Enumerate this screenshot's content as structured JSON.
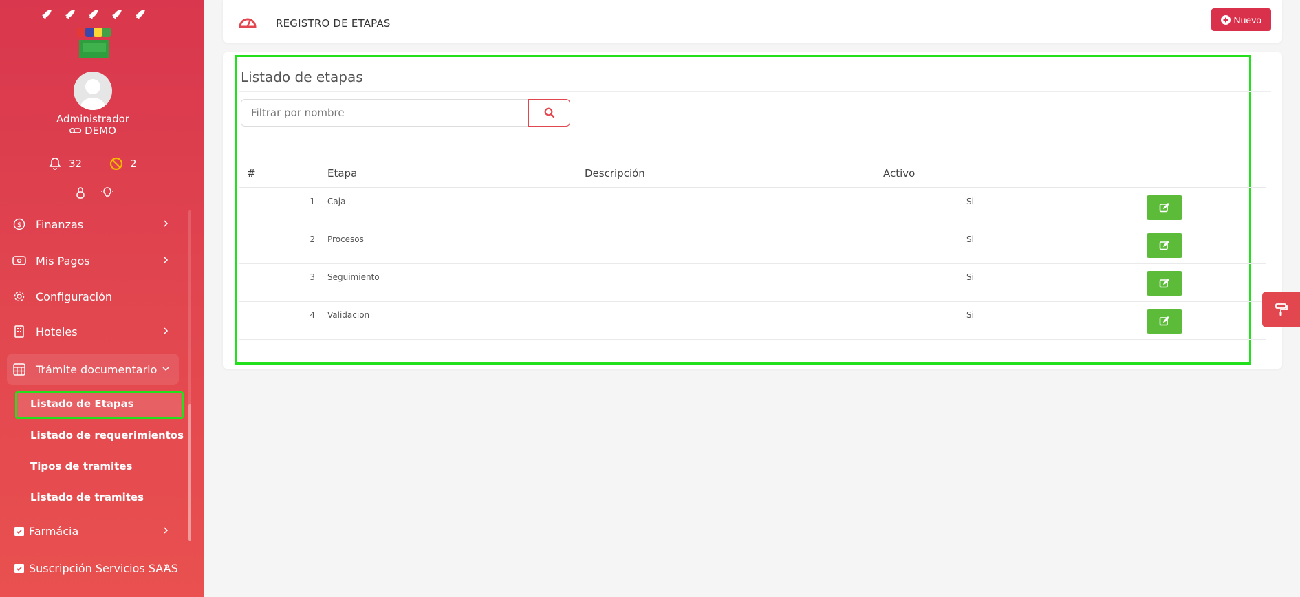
{
  "sidebar": {
    "user": {
      "name": "Administrador",
      "role": "DEMO"
    },
    "stats": {
      "notifications": "32",
      "blocked": "2"
    },
    "menu": {
      "finanzas": "Finanzas",
      "mis_pagos": "Mis Pagos",
      "configuracion": "Configuración",
      "hoteles": "Hoteles",
      "tramite": "Trámite documentario",
      "farmacia": "Farmácia",
      "suscripcion": "Suscripción Servicios SAAS"
    },
    "submenu": {
      "etapas": "Listado de Etapas",
      "requerimientos": "Listado de requerimientos",
      "tipos": "Tipos de tramites",
      "tramites": "Listado de tramites"
    }
  },
  "header": {
    "title": "REGISTRO DE ETAPAS",
    "new_label": "Nuevo"
  },
  "list": {
    "title": "Listado de etapas",
    "filter_placeholder": "Filtrar por nombre",
    "columns": {
      "num": "#",
      "stage": "Etapa",
      "desc": "Descripción",
      "active": "Activo"
    },
    "rows": [
      {
        "num": "1",
        "stage": "Caja",
        "desc": "",
        "active": "Si"
      },
      {
        "num": "2",
        "stage": "Procesos",
        "desc": "",
        "active": "Si"
      },
      {
        "num": "3",
        "stage": "Seguimiento",
        "desc": "",
        "active": "Si"
      },
      {
        "num": "4",
        "stage": "Validacion",
        "desc": "",
        "active": "Si"
      }
    ]
  },
  "colors": {
    "brand": "#d9374d",
    "accent_green": "#5dbb3a",
    "highlight": "#22e01c"
  },
  "icons": [
    "rocket-icon",
    "logo",
    "avatar",
    "bell-icon",
    "ban-icon",
    "lock-icon",
    "bulb-icon",
    "dollar-icon",
    "wallet-icon",
    "gear-icon",
    "building-icon",
    "calculator-icon",
    "calendar-check-icon",
    "chevron-right-icon",
    "chevron-down-icon",
    "dashboard-icon",
    "plus-circle-icon",
    "search-icon",
    "edit-icon",
    "paint-roller-icon"
  ]
}
